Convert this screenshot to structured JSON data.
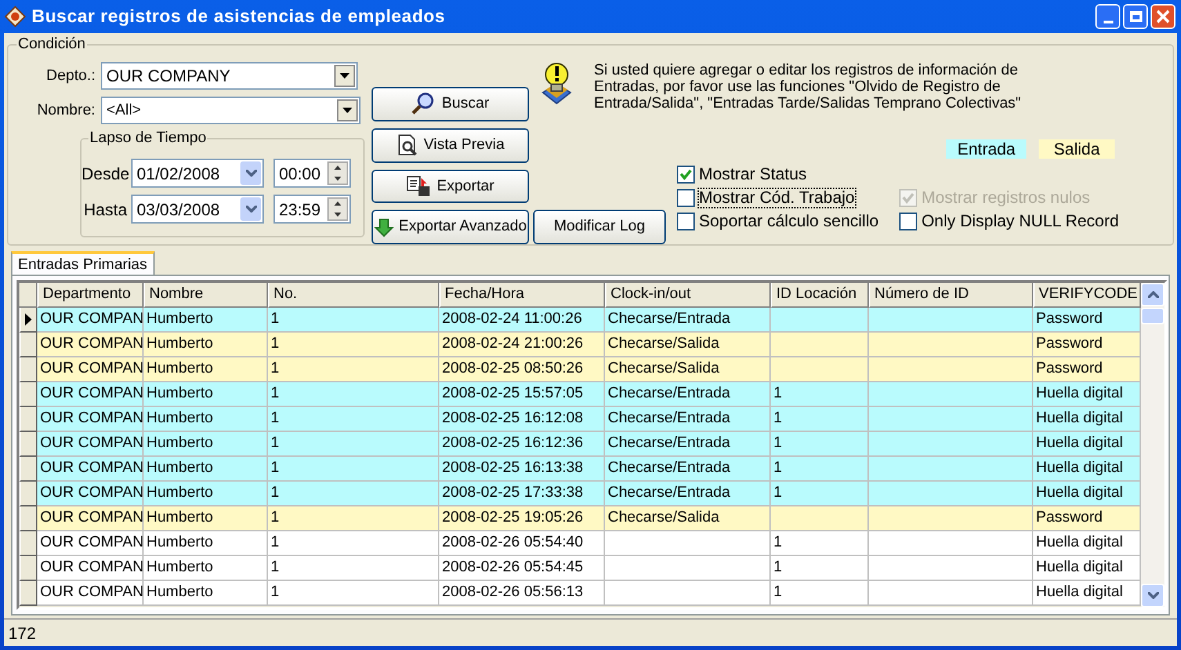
{
  "window": {
    "title": "Buscar registros de asistencias de empleados"
  },
  "condition": {
    "title": "Condición",
    "depto": {
      "label": "Depto.:",
      "value": "OUR COMPANY"
    },
    "nombre": {
      "label": "Nombre:",
      "value": "<All>"
    },
    "time_span": {
      "title": "Lapso de Tiempo",
      "from": {
        "label": "Desde",
        "date": "01/02/2008",
        "time": "00:00"
      },
      "to": {
        "label": "Hasta",
        "date": "03/03/2008",
        "time": "23:59"
      }
    },
    "buttons": [
      {
        "kind": "search",
        "label": "Buscar"
      },
      {
        "kind": "preview",
        "label": "Vista Previa"
      },
      {
        "kind": "export",
        "label": "Exportar"
      },
      {
        "kind": "export_advanced",
        "label": "Exportar Avanzado"
      }
    ],
    "info_text": "Si usted quiere agregar o editar los registros de información de Entradas, por favor use las funciones \"Olvido de Registro de Entrada/Salida\", \"Entradas Tarde/Salidas Temprano Colectivas\"",
    "modify_log_button": "Modificar Log",
    "checkboxes": [
      {
        "label": "Mostrar Status",
        "checked": true,
        "disabled": false,
        "focused": false
      },
      {
        "label": "Mostrar Cód. Trabajo",
        "checked": false,
        "disabled": false,
        "focused": true
      },
      {
        "label": "Soportar cálculo sencillo",
        "checked": false,
        "disabled": false,
        "focused": false
      },
      {
        "label": "Mostrar registros nulos",
        "checked": true,
        "disabled": true,
        "focused": false
      },
      {
        "label": "Only Display NULL Record",
        "checked": false,
        "disabled": false,
        "focused": false
      }
    ],
    "legend": [
      {
        "label": "Entrada",
        "color": "#b9fbfd"
      },
      {
        "label": "Salida",
        "color": "#fff9c4"
      }
    ]
  },
  "tabs": [
    {
      "label": "Entradas Primarias",
      "selected": true
    }
  ],
  "table": {
    "columns": [
      "Departmento",
      "Nombre",
      "No.",
      "Fecha/Hora",
      "Clock-in/out",
      "ID Locación",
      "Número de ID",
      "VERIFYCODE"
    ],
    "rows": [
      {
        "kind": "entrada",
        "current": true,
        "cells": [
          "OUR COMPAN",
          "Humberto",
          "1",
          "2008-02-24 11:00:26",
          "Checarse/Entrada",
          "",
          "",
          "Password"
        ]
      },
      {
        "kind": "salida",
        "current": false,
        "cells": [
          "OUR COMPAN",
          "Humberto",
          "1",
          "2008-02-24 21:00:26",
          "Checarse/Salida",
          "",
          "",
          "Password"
        ]
      },
      {
        "kind": "salida",
        "current": false,
        "cells": [
          "OUR COMPAN",
          "Humberto",
          "1",
          "2008-02-25 08:50:26",
          "Checarse/Salida",
          "",
          "",
          "Password"
        ]
      },
      {
        "kind": "entrada",
        "current": false,
        "cells": [
          "OUR COMPAN",
          "Humberto",
          "1",
          "2008-02-25 15:57:05",
          "Checarse/Entrada",
          "1",
          "",
          "Huella digital"
        ]
      },
      {
        "kind": "entrada",
        "current": false,
        "cells": [
          "OUR COMPAN",
          "Humberto",
          "1",
          "2008-02-25 16:12:08",
          "Checarse/Entrada",
          "1",
          "",
          "Huella digital"
        ]
      },
      {
        "kind": "entrada",
        "current": false,
        "cells": [
          "OUR COMPAN",
          "Humberto",
          "1",
          "2008-02-25 16:12:36",
          "Checarse/Entrada",
          "1",
          "",
          "Huella digital"
        ]
      },
      {
        "kind": "entrada",
        "current": false,
        "cells": [
          "OUR COMPAN",
          "Humberto",
          "1",
          "2008-02-25 16:13:38",
          "Checarse/Entrada",
          "1",
          "",
          "Huella digital"
        ]
      },
      {
        "kind": "entrada",
        "current": false,
        "cells": [
          "OUR COMPAN",
          "Humberto",
          "1",
          "2008-02-25 17:33:38",
          "Checarse/Entrada",
          "1",
          "",
          "Huella digital"
        ]
      },
      {
        "kind": "salida",
        "current": false,
        "cells": [
          "OUR COMPAN",
          "Humberto",
          "1",
          "2008-02-25 19:05:26",
          "Checarse/Salida",
          "",
          "",
          "Password"
        ]
      },
      {
        "kind": "none",
        "current": false,
        "cells": [
          "OUR COMPAN",
          "Humberto",
          "1",
          "2008-02-26 05:54:40",
          "",
          "1",
          "",
          "Huella digital"
        ]
      },
      {
        "kind": "none",
        "current": false,
        "cells": [
          "OUR COMPAN",
          "Humberto",
          "1",
          "2008-02-26 05:54:45",
          "",
          "1",
          "",
          "Huella digital"
        ]
      },
      {
        "kind": "none",
        "current": false,
        "cells": [
          "OUR COMPAN",
          "Humberto",
          "1",
          "2008-02-26 05:56:13",
          "",
          "1",
          "",
          "Huella digital"
        ]
      }
    ]
  },
  "status_bar": {
    "count": "172"
  }
}
